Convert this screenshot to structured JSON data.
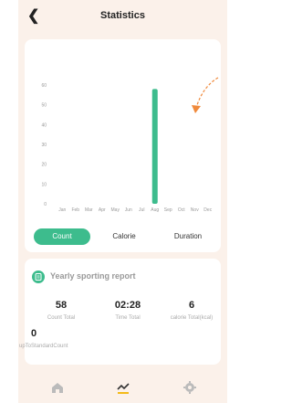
{
  "header": {
    "title": "Statistics"
  },
  "chart_data": {
    "type": "bar",
    "categories": [
      "Jan",
      "Feb",
      "Mar",
      "Apr",
      "May",
      "Jun",
      "Jul",
      "Aug",
      "Sep",
      "Oct",
      "Nov",
      "Dec"
    ],
    "values": [
      0,
      0,
      0,
      0,
      0,
      0,
      0,
      58,
      0,
      0,
      0,
      0
    ],
    "yticks": [
      0,
      10,
      20,
      30,
      40,
      50,
      60
    ],
    "ylim": [
      0,
      60
    ],
    "bar_color": "#3dbc8d",
    "grid": false
  },
  "annotation": {
    "color": "#f08a3c",
    "style": "dashed-curved-arrow"
  },
  "tabs": [
    {
      "label": "Count",
      "active": true
    },
    {
      "label": "Calorie",
      "active": false
    },
    {
      "label": "Duration",
      "active": false
    }
  ],
  "report": {
    "title": "Yearly sporting report",
    "icon": "report-icon",
    "stats": [
      {
        "value": "58",
        "label": "Count Total"
      },
      {
        "value": "02:28",
        "label": "Time Total"
      },
      {
        "value": "6",
        "label": "calorie Total(kcal)"
      },
      {
        "value": "0",
        "label": "upToStandardCount"
      }
    ]
  },
  "nav": {
    "items": [
      {
        "icon": "home-icon",
        "active": false
      },
      {
        "icon": "statistics-icon",
        "active": true
      },
      {
        "icon": "settings-icon",
        "active": false
      }
    ]
  },
  "colors": {
    "accent": "#3dbc8d",
    "background": "#fbf1ea",
    "active_nav": "#333333",
    "inactive_nav": "#bbbbbb"
  }
}
